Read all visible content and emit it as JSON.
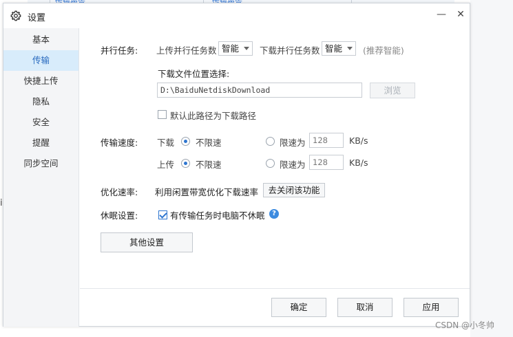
{
  "background": {
    "tab_text_left": "传输报告",
    "tab_text_right": "传输报告",
    "left_char": "i"
  },
  "dialog": {
    "title": "设置",
    "title_icon": "gear-icon",
    "minimize_glyph": "—",
    "close_glyph": "✕"
  },
  "sidebar": {
    "items": [
      {
        "label": "基本",
        "active": false
      },
      {
        "label": "传输",
        "active": true
      },
      {
        "label": "快捷上传",
        "active": false
      },
      {
        "label": "隐私",
        "active": false
      },
      {
        "label": "安全",
        "active": false
      },
      {
        "label": "提醒",
        "active": false
      },
      {
        "label": "同步空间",
        "active": false
      }
    ]
  },
  "parallel": {
    "label": "并行任务:",
    "upload_label": "上传并行任务数",
    "upload_value": "智能",
    "download_label": "下载并行任务数",
    "download_value": "智能",
    "hint": "(推荐智能)"
  },
  "download_location": {
    "label": "下载文件位置选择:",
    "path": "D:\\BaiduNetdiskDownload",
    "browse_label": "浏览",
    "default_checkbox_label": "默认此路径为下载路径",
    "default_checked": false
  },
  "speed": {
    "label": "传输速度:",
    "download": {
      "label": "下载",
      "unlimited_label": "不限速",
      "limit_label": "限速为",
      "limit_value": "128",
      "unit": "KB/s",
      "selected": "unlimited"
    },
    "upload": {
      "label": "上传",
      "unlimited_label": "不限速",
      "limit_label": "限速为",
      "limit_value": "128",
      "unit": "KB/s",
      "selected": "unlimited"
    }
  },
  "optimize": {
    "label": "优化速率:",
    "text": "利用闲置带宽优化下载速率",
    "button_label": "去关闭该功能"
  },
  "sleep": {
    "label": "休眠设置:",
    "checkbox_label": "有传输任务时电脑不休眠",
    "checked": true,
    "help_glyph": "?"
  },
  "other_settings_label": "其他设置",
  "footer": {
    "ok_label": "确定",
    "cancel_label": "取消",
    "apply_label": "应用"
  },
  "watermark": "CSDN @小冬帅",
  "colors": {
    "accent": "#2e76d0",
    "active_bg": "#d8ecfb",
    "sidebar_bg": "#f4f5f7"
  }
}
